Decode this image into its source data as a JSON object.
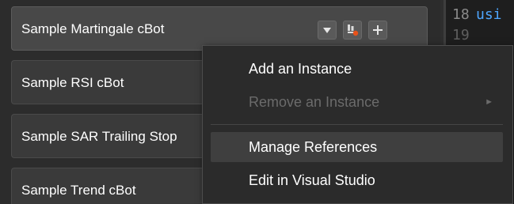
{
  "bot_list": {
    "items": [
      {
        "label": "Sample Martingale cBot"
      },
      {
        "label": "Sample RSI cBot"
      },
      {
        "label": "Sample SAR Trailing Stop"
      },
      {
        "label": "Sample Trend cBot"
      }
    ],
    "item_buttons": {
      "dropdown_icon": "chevron-down-icon",
      "references_icon": "references-icon",
      "add_icon": "plus-icon"
    }
  },
  "editor": {
    "line_numbers": [
      "18",
      "19"
    ],
    "code_fragment": "usi"
  },
  "context_menu": {
    "items": [
      {
        "label": "Add an Instance",
        "enabled": true
      },
      {
        "label": "Remove an Instance",
        "enabled": false,
        "submenu": true,
        "submenu_icon": "triangle-right-icon"
      },
      {
        "label": "Manage References",
        "enabled": true,
        "highlighted": true
      },
      {
        "label": "Edit in Visual Studio",
        "enabled": true
      }
    ]
  },
  "colors": {
    "background": "#2e2e2e",
    "item_bg": "#3a3a3a",
    "menu_bg": "#2b2b2b",
    "highlight_bg": "#3f3f3f",
    "disabled_text": "#6b6b6b",
    "accent_orange": "#e8521a",
    "code_keyword": "#4ea6ff"
  }
}
